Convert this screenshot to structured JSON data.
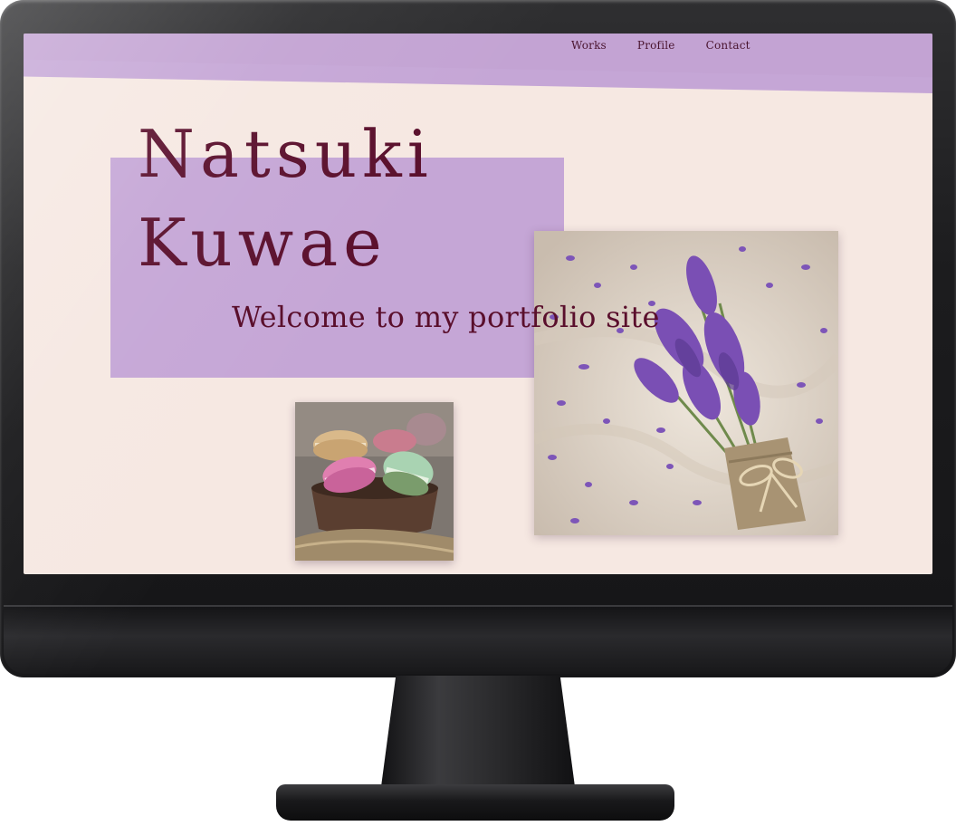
{
  "nav": {
    "items": [
      {
        "label": "Works"
      },
      {
        "label": "Profile"
      },
      {
        "label": "Contact"
      }
    ]
  },
  "hero": {
    "first_name": "Natsuki",
    "last_name": "Kuwae",
    "welcome": "Welcome to my portfolio site"
  },
  "colors": {
    "page_background": "#f6e8e2",
    "accent_purple": "#c5a6d6",
    "text_plum": "#5a0f2c",
    "frame": "#1c1c1e"
  },
  "images": {
    "lavender": {
      "icon": "lavender-bouquet-photo"
    },
    "macarons": {
      "icon": "macarons-bowl-photo"
    }
  }
}
